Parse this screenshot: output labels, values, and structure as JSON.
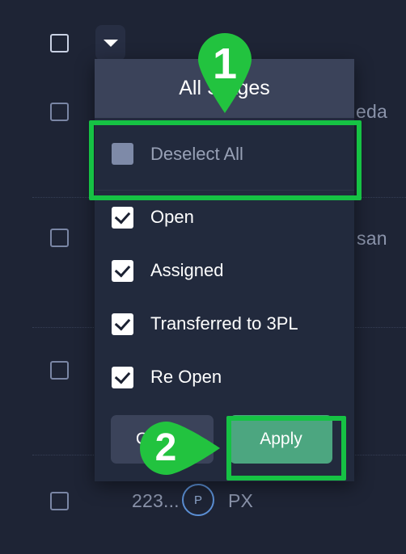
{
  "dropdown": {
    "trigger_icon": "caret-down-icon",
    "header_title": "All Stages",
    "deselect_all": {
      "label": "Deselect All",
      "state": "indeterminate",
      "checkbox_icon": "indeterminate-checkbox-icon"
    },
    "options": [
      {
        "label": "Open",
        "checked": true
      },
      {
        "label": "Assigned",
        "checked": true
      },
      {
        "label": "Transferred to 3PL",
        "checked": true
      },
      {
        "label": "Re Open",
        "checked": true
      }
    ],
    "footer": {
      "cancel_label": "Cancel",
      "apply_label": "Apply"
    }
  },
  "background_table": {
    "rows": [
      {
        "checkbox_checked": false,
        "text": "eda"
      },
      {
        "checkbox_checked": false,
        "text": "san"
      },
      {
        "checkbox_checked": false,
        "text": ""
      },
      {
        "checkbox_checked": false,
        "text": "223...",
        "avatar": "P",
        "suffix": "PX"
      }
    ]
  },
  "annotations": {
    "step_one": "1",
    "step_two": "2",
    "highlight_color": "#16c244",
    "marker_color": "#22c33f",
    "targets": {
      "one": "deselect-all-row",
      "two": "apply-button"
    }
  },
  "colors": {
    "page_background": "#1e2435",
    "panel_background": "#222a3d",
    "panel_header": "#3b435a",
    "apply_green": "#4ca680",
    "cancel_slate": "#3b435a",
    "accent_green": "#16c244",
    "muted_text": "#8b94ab"
  }
}
